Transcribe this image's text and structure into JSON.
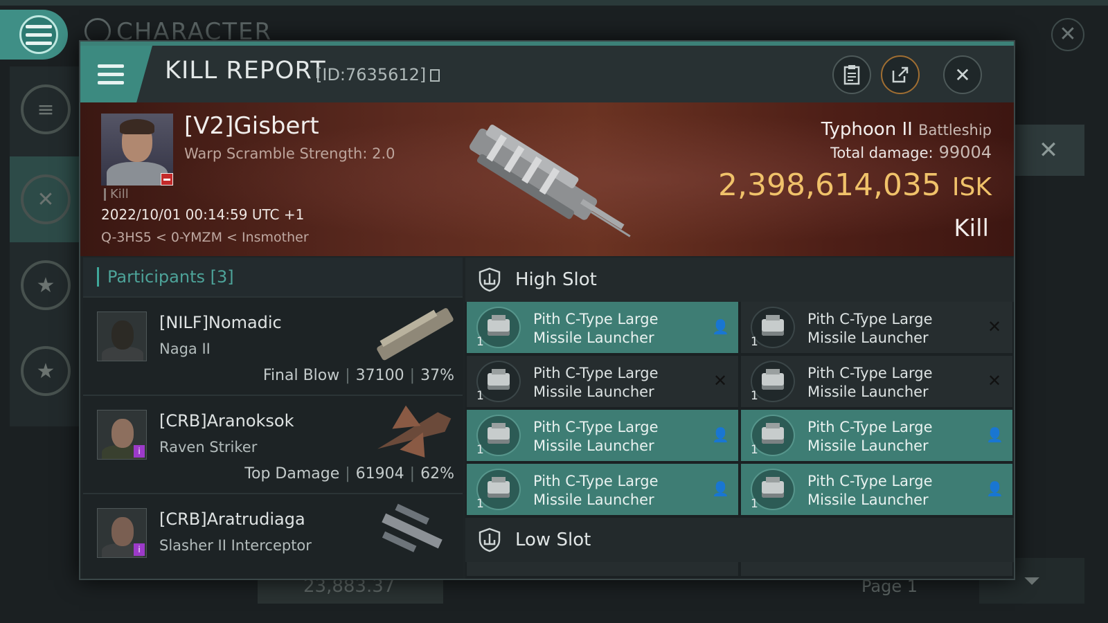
{
  "background": {
    "title": "CHARACTER",
    "bottom_left_value": "23,883.37",
    "bottom_page": "Page 1"
  },
  "header": {
    "title": "KILL REPORT",
    "id": "[ID:7635612]"
  },
  "victim": {
    "name": "[V2]Gisbert",
    "subtitle": "Warp Scramble Strength: 2.0",
    "tag": "Kill",
    "datetime": "2022/10/01 00:14:59 UTC +1",
    "location": "Q-3HS5 < 0-YMZM < Insmother",
    "ship_name": "Typhoon II",
    "ship_class": "Battleship",
    "total_damage_label": "Total damage:",
    "total_damage_value": "99004",
    "isk_value": "2,398,614,035",
    "isk_unit": "ISK",
    "result": "Kill"
  },
  "participants": {
    "heading": "Participants [3]",
    "rows": [
      {
        "name": "[NILF]Nomadic",
        "ship": "Naga II",
        "role": "Final Blow",
        "damage": "37100",
        "percent": "37%"
      },
      {
        "name": "[CRB]Aranoksok",
        "ship": "Raven Striker",
        "role": "Top Damage",
        "damage": "61904",
        "percent": "62%"
      },
      {
        "name": "[CRB]Aratrudiaga",
        "ship": "Slasher II Interceptor",
        "role": "",
        "damage": "",
        "percent": ""
      }
    ]
  },
  "high_slot": {
    "heading": "High Slot",
    "modules": [
      {
        "name": "Pith C-Type Large Missile Launcher",
        "qty": "1",
        "status": "dropped"
      },
      {
        "name": "Pith C-Type Large Missile Launcher",
        "qty": "1",
        "status": "destroyed"
      },
      {
        "name": "Pith C-Type Large Missile Launcher",
        "qty": "1",
        "status": "destroyed"
      },
      {
        "name": "Pith C-Type Large Missile Launcher",
        "qty": "1",
        "status": "destroyed"
      },
      {
        "name": "Pith C-Type Large Missile Launcher",
        "qty": "1",
        "status": "dropped"
      },
      {
        "name": "Pith C-Type Large Missile Launcher",
        "qty": "1",
        "status": "dropped"
      },
      {
        "name": "Pith C-Type Large Missile Launcher",
        "qty": "1",
        "status": "dropped"
      },
      {
        "name": "Pith C-Type Large Missile Launcher",
        "qty": "1",
        "status": "dropped"
      }
    ]
  },
  "low_slot": {
    "heading": "Low Slot"
  },
  "colors": {
    "accent": "#3c8a80",
    "isk": "#f0c26a",
    "fitted_row": "#3e7d74"
  }
}
